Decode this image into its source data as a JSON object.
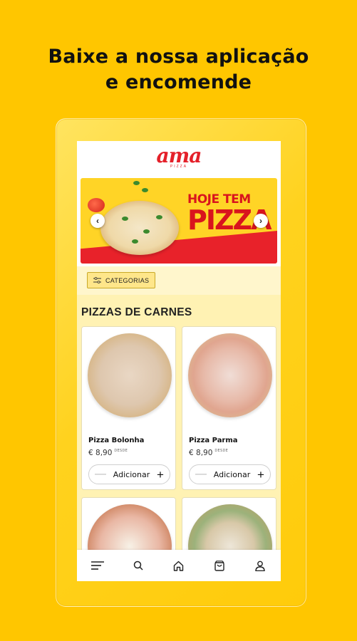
{
  "headline": {
    "line1": "Baixe a nossa aplicação",
    "line2": "e encomende"
  },
  "app": {
    "logo": "ama",
    "logo_sub": "PIZZA",
    "banner": {
      "line1": "HOJE TEM",
      "line2": "PIZZA",
      "prev_icon": "chevron-left-icon",
      "next_icon": "chevron-right-icon"
    },
    "categories_button": "CATEGORIAS",
    "section_title": "PIZZAS DE CARNES",
    "products": [
      {
        "name": "Pizza Bolonha",
        "price": "€ 8,90",
        "price_note": "DESDE",
        "add_label": "Adicionar"
      },
      {
        "name": "Pizza Parma",
        "price": "€ 8,90",
        "price_note": "DESDE",
        "add_label": "Adicionar"
      }
    ],
    "bottom_nav": [
      "menu-icon",
      "search-icon",
      "home-icon",
      "cart-icon",
      "user-icon"
    ]
  },
  "colors": {
    "background": "#FFC600",
    "brand_red": "#E4202A",
    "section_bg": "#FFF2B3"
  }
}
